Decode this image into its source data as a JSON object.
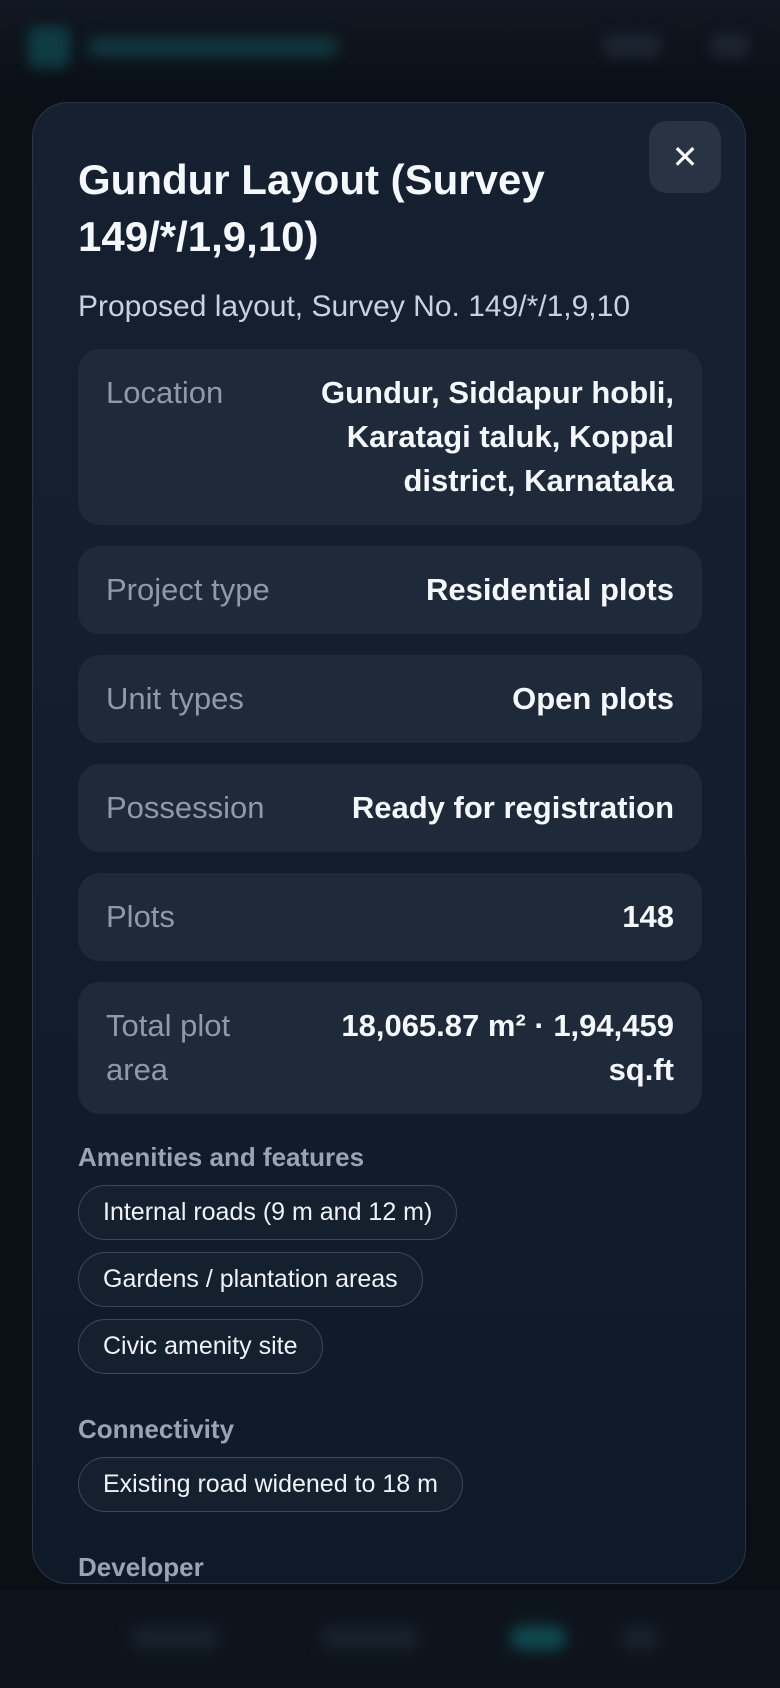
{
  "modal": {
    "title": "Gundur Layout (Survey 149/*/1,9,10)",
    "subtitle": "Proposed layout, Survey No. 149/*/1,9,10",
    "close_label": "✕",
    "details": [
      {
        "label": "Location",
        "value": "Gundur, Siddapur hobli, Karatagi taluk, Koppal district, Karnataka"
      },
      {
        "label": "Project type",
        "value": "Residential plots"
      },
      {
        "label": "Unit types",
        "value": "Open plots"
      },
      {
        "label": "Possession",
        "value": "Ready for registration"
      },
      {
        "label": "Plots",
        "value": "148"
      },
      {
        "label": "Total plot area",
        "value": "18,065.87 m² · 1,94,459 sq.ft"
      }
    ],
    "amenities": {
      "title": "Amenities and features",
      "items": [
        "Internal roads (9 m and 12 m)",
        "Gardens / plantation areas",
        "Civic amenity site"
      ]
    },
    "connectivity": {
      "title": "Connectivity",
      "items": [
        "Existing road widened to 18 m"
      ]
    },
    "developer": {
      "title": "Developer"
    }
  }
}
